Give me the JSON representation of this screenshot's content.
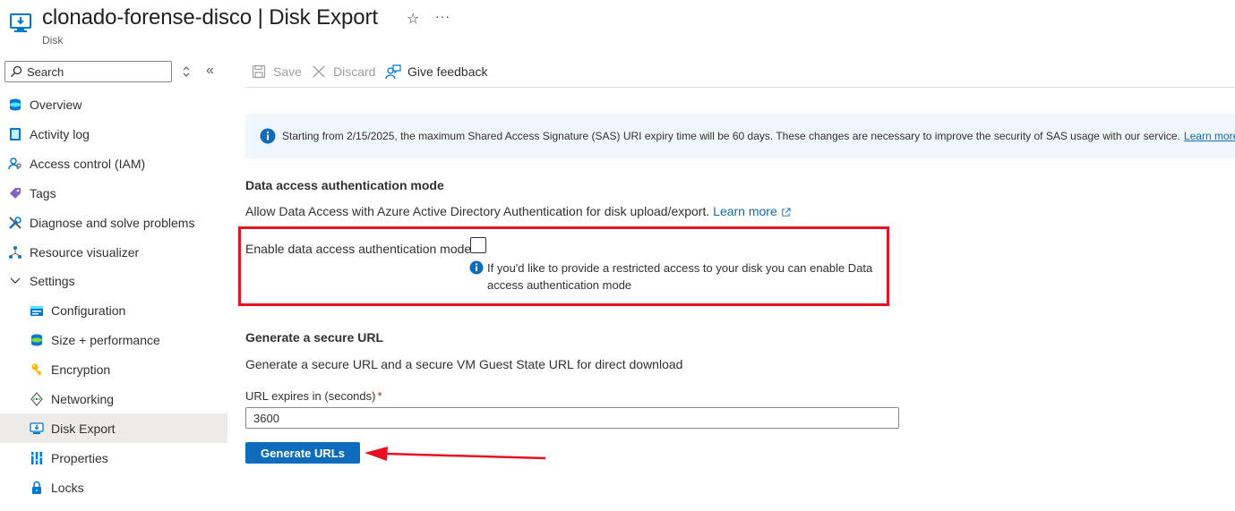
{
  "header": {
    "title": "clonado-forense-disco | Disk Export",
    "subtitle": "Disk",
    "favorite_icon": "star-icon",
    "more_icon": "ellipsis-icon",
    "more_text": "···"
  },
  "sidebar": {
    "search_placeholder": "Search",
    "collapse_text": "«",
    "items": [
      {
        "label": "Overview",
        "icon": "overview-icon",
        "level": 1
      },
      {
        "label": "Activity log",
        "icon": "activity-log-icon",
        "level": 1
      },
      {
        "label": "Access control (IAM)",
        "icon": "iam-icon",
        "level": 1
      },
      {
        "label": "Tags",
        "icon": "tag-icon",
        "level": 1
      },
      {
        "label": "Diagnose and solve problems",
        "icon": "wrench-icon",
        "level": 1
      },
      {
        "label": "Resource visualizer",
        "icon": "visualizer-icon",
        "level": 1
      },
      {
        "label": "Settings",
        "icon": "chevron-down-icon",
        "level": 1
      },
      {
        "label": "Configuration",
        "icon": "configuration-icon",
        "level": 2
      },
      {
        "label": "Size + performance",
        "icon": "size-performance-icon",
        "level": 2
      },
      {
        "label": "Encryption",
        "icon": "key-icon",
        "level": 2
      },
      {
        "label": "Networking",
        "icon": "networking-icon",
        "level": 2
      },
      {
        "label": "Disk Export",
        "icon": "disk-export-icon",
        "level": 2,
        "selected": true
      },
      {
        "label": "Properties",
        "icon": "properties-icon",
        "level": 2
      },
      {
        "label": "Locks",
        "icon": "lock-icon",
        "level": 2
      }
    ]
  },
  "toolbar": {
    "save_label": "Save",
    "discard_label": "Discard",
    "feedback_label": "Give feedback"
  },
  "banner": {
    "text": "Starting from 2/15/2025, the maximum Shared Access Signature (SAS) URI expiry time will be 60 days. These changes are necessary to improve the security of SAS usage with our service.",
    "link": "Learn more"
  },
  "data_access": {
    "title": "Data access authentication mode",
    "description": "Allow Data Access with Azure Active Directory Authentication for disk upload/export.",
    "learn_more": "Learn more",
    "field_label": "Enable data access authentication mode",
    "checked": false,
    "hint": "If you'd like to provide a restricted access to your disk you can enable Data access authentication mode"
  },
  "secure_url": {
    "title": "Generate a secure URL",
    "description": "Generate a secure URL and a secure VM Guest State URL for direct download",
    "expiry_label": "URL expires in (seconds)",
    "required_mark": "*",
    "expiry_value": "3600",
    "generate_label": "Generate URLs"
  },
  "colors": {
    "accent": "#0f6cbd",
    "highlight_box": "#e81123",
    "banner_bg": "#eff6fc"
  }
}
